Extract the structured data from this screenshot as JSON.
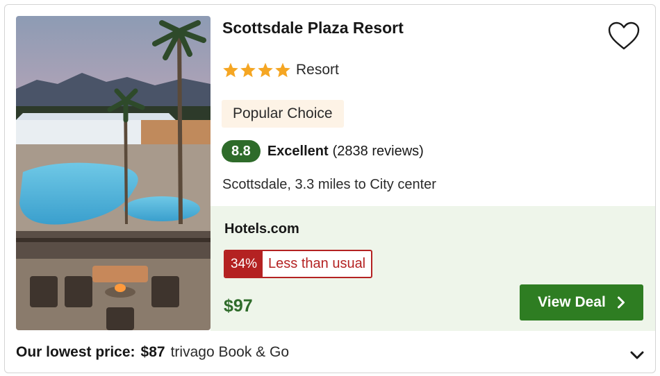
{
  "hotel": {
    "name": "Scottsdale Plaza Resort",
    "star_count": 4,
    "type": "Resort",
    "badge": "Popular Choice",
    "rating": {
      "score": "8.8",
      "label": "Excellent",
      "reviews": "(2838 reviews)"
    },
    "location": "Scottsdale, 3.3 miles to City center"
  },
  "deal": {
    "provider": "Hotels.com",
    "discount_percent": "34%",
    "discount_text": "Less than usual",
    "price": "$97",
    "button_label": "View Deal"
  },
  "lowest": {
    "label": "Our lowest price:",
    "price": "$87",
    "provider": "trivago Book & Go"
  },
  "colors": {
    "star": "#f5a623",
    "rating_green": "#2e6b2a",
    "button_green": "#2e7d22",
    "discount_red": "#b42222",
    "deal_bg": "#eef5ea",
    "badge_bg": "#fdf3e6"
  },
  "icons": [
    "heart-outline-icon",
    "star-icon",
    "chevron-right-icon",
    "chevron-down-icon"
  ]
}
